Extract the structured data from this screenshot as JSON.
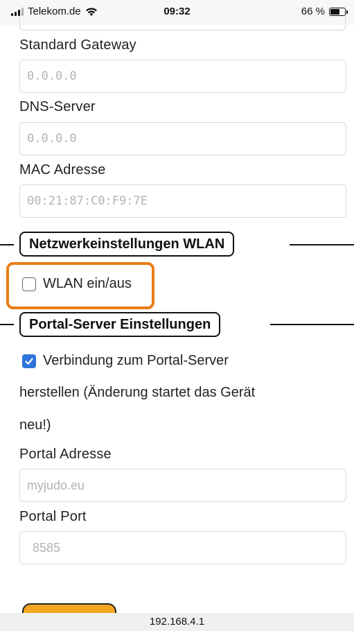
{
  "status_bar": {
    "carrier": "Telekom.de",
    "time": "09:32",
    "battery_text": "66 %",
    "battery_level": 0.66
  },
  "fields": {
    "gateway": {
      "label": "Standard Gateway",
      "placeholder": "0.0.0.0"
    },
    "dns": {
      "label": "DNS-Server",
      "placeholder": "0.0.0.0"
    },
    "mac": {
      "label": "MAC Adresse",
      "placeholder": "00:21:87:C0:F9:7E"
    },
    "portal_address": {
      "label": "Portal Adresse",
      "placeholder": "myjudo.eu"
    },
    "portal_port": {
      "label": "Portal Port",
      "placeholder": "8585"
    }
  },
  "sections": {
    "wlan": {
      "title": "Netzwerkeinstellungen WLAN",
      "toggle_label": "WLAN ein/aus",
      "toggle_checked": false
    },
    "portal": {
      "title": "Portal-Server Einstellungen",
      "connect_label_lines": [
        "Verbindung zum Portal-Server",
        "herstellen (Änderung startet das Gerät",
        "neu!)"
      ],
      "connect_checked": true
    }
  },
  "url_bar": {
    "url": "192.168.4.1"
  },
  "colors": {
    "highlight": "#ea7d16",
    "checkbox_checked": "#2f73db",
    "button": "#f4a623"
  }
}
